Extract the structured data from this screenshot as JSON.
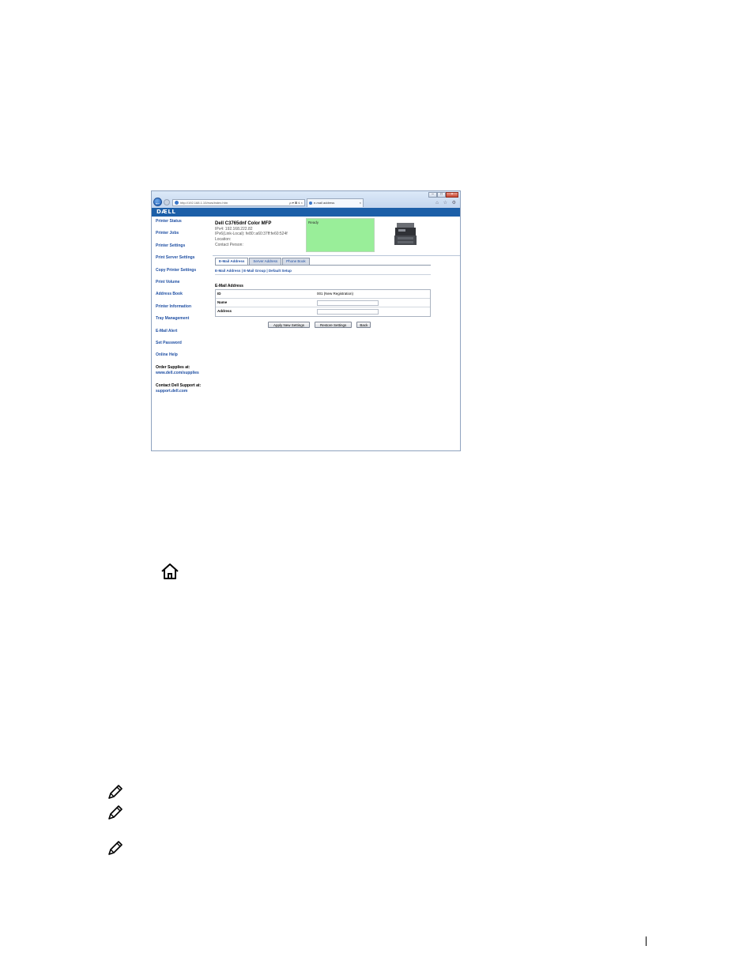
{
  "browser": {
    "address_url": "http://192.168.1.10/ews/index.htm",
    "tab_title": "e-mail address",
    "address_tools": "ρ ▾ ⊠ ¢ ×",
    "tab_close": "×",
    "window_controls": [
      "–",
      "□",
      "×"
    ],
    "command_icons": "⌂ ☆ ⚙",
    "back_glyph": "←"
  },
  "ews": {
    "brand": "DÆLL",
    "nav": [
      "Printer Status",
      "Printer Jobs",
      "Printer Settings",
      "Print Server Settings",
      "Copy Printer Settings",
      "Print Volume",
      "Address Book",
      "Printer Information",
      "Tray Management",
      "E-Mail Alert",
      "Set Password",
      "Online Help"
    ],
    "order_supplies": {
      "label": "Order Supplies at:",
      "url": "www.dell.com/supplies"
    },
    "contact_support": {
      "label": "Contact Dell Support at:",
      "url": "support.dell.com"
    },
    "printer": {
      "name": "Dell C3765dnf Color MFP",
      "ipv4": "IPv4: 192.168.222.82",
      "ipv6": "IPv6(Link-Local): fe80::a60:37ff:fe60:524f",
      "location": "Location:",
      "contact": "Contact Person:",
      "status": "Ready"
    },
    "tabs": [
      "E-Mail Address",
      "Server Address",
      "Phone Book"
    ],
    "subnav": "E-Mail Address | E-Mail Group | Default Setup",
    "section_title": "E-Mail Address",
    "form": {
      "id_label": "ID",
      "id_value": "001  (New Registration)",
      "name_label": "Name",
      "address_label": "Address"
    },
    "buttons": {
      "apply": "Apply New Settings",
      "restore": "Restore Settings",
      "back": "Back"
    }
  },
  "colors": {
    "dell_blue": "#1c5fa8",
    "status_ready": "#99ee99",
    "link_blue": "#1f4fa3"
  },
  "icons": [
    "home-icon",
    "note-pencil-icon"
  ]
}
